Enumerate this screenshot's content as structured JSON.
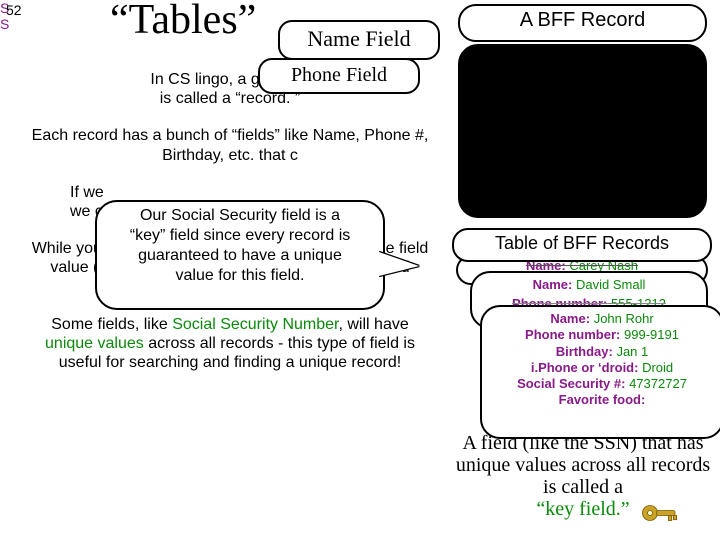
{
  "page_number": "52",
  "title": "“Tables”",
  "left_paragraphs": {
    "p1_a": "In CS lingo, a group of ",
    "p1_b": "is called a “record. ”",
    "p2": "Each record has a bunch of “fields” like Name, Phone #, Birthday, etc. that c",
    "p3": "If we \nwe c",
    "p4_a": "While you may have many records ",
    "p4_b": "the same Name field value (e.g. , John Smith) or the same Birthday field value (e.g. , Jan 1",
    "p4_c": ")…",
    "p5_a": "Some fields, like ",
    "p5_key": "Social Security Number",
    "p5_b": ", will have ",
    "p5_key2": "unique values",
    "p5_c": " across all records - this type of field is useful for searching and finding a unique record!"
  },
  "annotations": {
    "name_field": "Name Field",
    "phone_field": "Phone Field"
  },
  "callout": {
    "line1": "Our Social Security field is a",
    "line2": "“key” field since every record is",
    "line3": "guaranteed to have a unique",
    "line4": "value for this field."
  },
  "right": {
    "bff_title": "A BFF Record",
    "table_title": "Table of BFF Records",
    "card1": {
      "name_label": "Name:",
      "name_val": "Carey Nash"
    },
    "card2": {
      "name_label": "Name:",
      "name_val": "David Small",
      "phone_label": "Phone number:",
      "phone_val": "555-1212"
    },
    "card3": {
      "name_label": "Name:",
      "name_val": "John Rohr",
      "phone_label": "Phone number:",
      "phone_val": "999-9191",
      "bday_label": "Birthday:",
      "bday_val": "Jan 1",
      "device_label": "i.Phone or ‘droid:",
      "device_val": "Droid",
      "ssn_label": "Social Security #:",
      "ssn_val": "47372727",
      "food_label": "Favorite food:"
    },
    "peek_left_s1": "S",
    "peek_left_s2": "S",
    "keyfield_text_a": "A field (like the SSN) that has unique values across all records is called a",
    "keyfield_text_b": "“key field.”"
  }
}
